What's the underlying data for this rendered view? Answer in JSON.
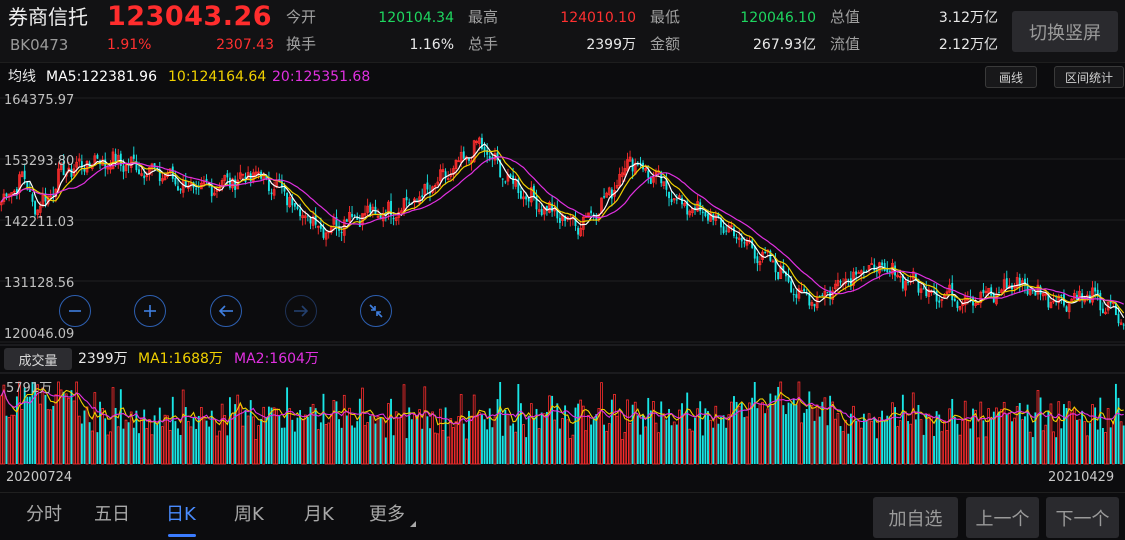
{
  "header": {
    "name": "券商信托",
    "code": "BK0473",
    "price": "123043.26",
    "change_pct": "1.91%",
    "change_abs": "2307.43",
    "open_label": "今开",
    "open_value": "120104.34",
    "high_label": "最高",
    "high_value": "124010.10",
    "low_label": "最低",
    "low_value": "120046.10",
    "total_cap_label": "总值",
    "total_cap_value": "3.12万亿",
    "turnover_label": "换手",
    "turnover_value": "1.16%",
    "volume_label": "总手",
    "volume_value": "2399万",
    "amount_label": "金额",
    "amount_value": "267.93亿",
    "float_cap_label": "流值",
    "float_cap_value": "2.12万亿",
    "switch_label": "切换竖屏"
  },
  "ma_legend": {
    "label": "均线",
    "ma5": "MA5:122381.96",
    "ma10": "10:124164.64",
    "ma20": "20:125351.68",
    "draw_button": "画线",
    "range_button": "区间统计"
  },
  "volume_legend": {
    "tag": "成交量",
    "vol": "2399万",
    "ma1": "MA1:1688万",
    "ma2": "MA2:1604万"
  },
  "dates": {
    "start": "20200724",
    "end": "20210429"
  },
  "colors": {
    "up": "#ff2d2d",
    "down": "#19e6e6",
    "ma5": "#ffffff",
    "ma10": "#f0d000",
    "ma20": "#e030e0",
    "accent": "#3b7cff"
  },
  "zoom_controls": [
    {
      "name": "zoom-out-icon",
      "symbol": "minus"
    },
    {
      "name": "zoom-in-icon",
      "symbol": "plus"
    },
    {
      "name": "scroll-left-icon",
      "symbol": "arrow-left"
    },
    {
      "name": "scroll-right-icon",
      "symbol": "arrow-right"
    },
    {
      "name": "reset-zoom-icon",
      "symbol": "compress"
    }
  ],
  "bottom_nav": {
    "tabs": [
      "分时",
      "五日",
      "日K",
      "周K",
      "月K",
      "更多"
    ],
    "active_tab": "日K",
    "add_watch": "加自选",
    "prev": "上一个",
    "next": "下一个"
  },
  "chart_data": {
    "type": "candlestick",
    "price_axis_labels": [
      "164375.97",
      "153293.80",
      "142211.03",
      "131128.56",
      "120046.09"
    ],
    "volume_axis_label": "5791万",
    "price_range": [
      120046.09,
      164375.97
    ],
    "grid": true,
    "ma_periods": [
      5,
      10,
      20
    ],
    "close_path_keypoints": [
      [
        0,
        145500
      ],
      [
        8,
        150000
      ],
      [
        14,
        144000
      ],
      [
        24,
        151000
      ],
      [
        36,
        153000
      ],
      [
        48,
        152500
      ],
      [
        62,
        150500
      ],
      [
        75,
        147500
      ],
      [
        86,
        149000
      ],
      [
        98,
        150500
      ],
      [
        108,
        147500
      ],
      [
        118,
        142500
      ],
      [
        126,
        140500
      ],
      [
        134,
        143000
      ],
      [
        148,
        143500
      ],
      [
        162,
        146500
      ],
      [
        176,
        152000
      ],
      [
        184,
        156000
      ],
      [
        194,
        150000
      ],
      [
        204,
        146000
      ],
      [
        214,
        143000
      ],
      [
        222,
        141500
      ],
      [
        232,
        145500
      ],
      [
        242,
        153500
      ],
      [
        252,
        149500
      ],
      [
        262,
        145000
      ],
      [
        270,
        143500
      ],
      [
        280,
        140500
      ],
      [
        290,
        136500
      ],
      [
        300,
        133000
      ],
      [
        308,
        128000
      ],
      [
        316,
        128300
      ],
      [
        326,
        132200
      ],
      [
        334,
        133500
      ],
      [
        344,
        132500
      ],
      [
        352,
        130500
      ],
      [
        362,
        128500
      ],
      [
        372,
        128000
      ],
      [
        382,
        128500
      ],
      [
        390,
        131000
      ],
      [
        398,
        129200
      ],
      [
        408,
        127500
      ],
      [
        418,
        128500
      ],
      [
        428,
        125500
      ],
      [
        432,
        123043
      ]
    ]
  }
}
